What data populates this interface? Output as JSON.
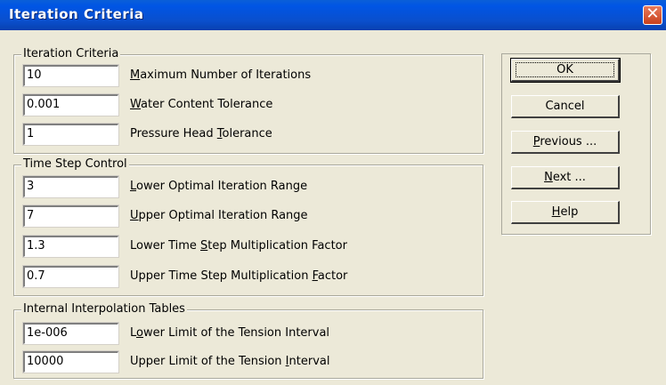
{
  "window": {
    "title": "Iteration Criteria",
    "close_glyph": "✕"
  },
  "groups": [
    {
      "title": "Iteration Criteria",
      "rows": [
        {
          "value": "10",
          "label_pre": "",
          "mnemonic": "M",
          "label_post": "aximum Number of Iterations"
        },
        {
          "value": "0.001",
          "label_pre": "",
          "mnemonic": "W",
          "label_post": "ater Content Tolerance"
        },
        {
          "value": "1",
          "label_pre": "Pressure Head ",
          "mnemonic": "T",
          "label_post": "olerance"
        }
      ]
    },
    {
      "title": "Time Step Control",
      "rows": [
        {
          "value": "3",
          "label_pre": "",
          "mnemonic": "L",
          "label_post": "ower Optimal Iteration Range"
        },
        {
          "value": "7",
          "label_pre": "",
          "mnemonic": "U",
          "label_post": "pper Optimal Iteration Range"
        },
        {
          "value": "1.3",
          "label_pre": "Lower Time ",
          "mnemonic": "S",
          "label_post": "tep Multiplication Factor"
        },
        {
          "value": "0.7",
          "label_pre": "Upper Time Step Multiplication ",
          "mnemonic": "F",
          "label_post": "actor"
        }
      ]
    },
    {
      "title": "Internal Interpolation Tables",
      "rows": [
        {
          "value": "1e-006",
          "label_pre": "L",
          "mnemonic": "o",
          "label_post": "wer Limit of the Tension Interval"
        },
        {
          "value": "10000",
          "label_pre": "Upper Limit of the Tension ",
          "mnemonic": "I",
          "label_post": "nterval"
        }
      ]
    }
  ],
  "buttons": {
    "ok": {
      "pre": "",
      "mnemonic": "",
      "post": "OK"
    },
    "cancel": {
      "pre": "",
      "mnemonic": "",
      "post": "Cancel"
    },
    "previous": {
      "pre": "",
      "mnemonic": "P",
      "post": "revious ..."
    },
    "next": {
      "pre": "",
      "mnemonic": "N",
      "post": "ext ..."
    },
    "help": {
      "pre": "",
      "mnemonic": "H",
      "post": "elp"
    }
  }
}
